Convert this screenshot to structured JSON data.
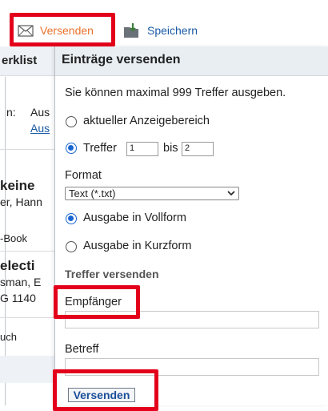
{
  "toolbar": {
    "send_label": "Versenden",
    "save_label": "Speichern",
    "send_icon": "envelope-icon",
    "save_icon": "folder-download-icon"
  },
  "background": {
    "header_text": "erklist",
    "line1_label": "n:",
    "line1_value": "Aus",
    "line1_link": "Aus",
    "item1_title": "keine",
    "item1_author": "er, Hann",
    "item1_type": "-Book",
    "item2_title": "electi",
    "item2_author": "sman, E",
    "item2_sig": "G 1140",
    "item3_type": "uch"
  },
  "dialog": {
    "title": "Einträge versenden",
    "info": "Sie können maximal 999 Treffer ausgeben.",
    "radio_current": "aktueller Anzeigebereich",
    "radio_hits": "Treffer",
    "hits_from": "1",
    "hits_to_label": "bis",
    "hits_to": "2",
    "format_label": "Format",
    "format_selected": "Text (*.txt)",
    "radio_full": "Ausgabe in Vollform",
    "radio_short": "Ausgabe in Kurzform",
    "send_section": "Treffer versenden",
    "recipient_label": "Empfänger",
    "subject_label": "Betreff",
    "submit_label": "Versenden"
  },
  "colors": {
    "highlight": "#e3001b",
    "link": "#1a5aa6",
    "accent_orange": "#e8722c",
    "radio_selected": "#1a66d2"
  }
}
